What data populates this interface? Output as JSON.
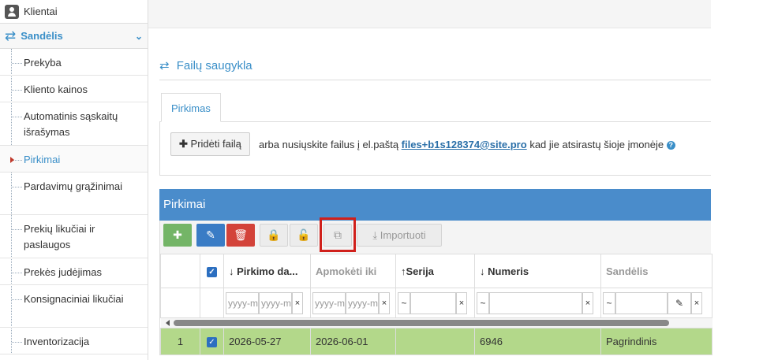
{
  "sidebar": {
    "top_item": "Klientai",
    "section": "Sandėlis",
    "items": [
      {
        "label": "Prekyba"
      },
      {
        "label": "Kliento kainos"
      },
      {
        "label": "Automatinis sąskaitų išrašymas"
      },
      {
        "label": "Pirkimai"
      },
      {
        "label": "Pardavimų grąžinimai"
      },
      {
        "label": "Prekių likučiai ir paslaugos"
      },
      {
        "label": "Prekės judėjimas"
      },
      {
        "label": "Konsignaciniai likučiai"
      },
      {
        "label": "Inventorizacija"
      }
    ]
  },
  "main": {
    "storage_title": "Failų saugykla",
    "tab_label": "Pirkimas",
    "add_file_label": "Pridėti failą",
    "upload_prefix": "arba nusiųskite failus į el.paštą",
    "upload_email": "files+b1s128374@site.pro",
    "upload_suffix": "kad jie atsirastų šioje įmonėje"
  },
  "grid": {
    "title": "Pirkimai",
    "import_label": "Importuoti",
    "columns": {
      "date": "Pirkimo da...",
      "pay_until": "Apmokėti iki",
      "series": "Serija",
      "number": "Numeris",
      "warehouse": "Sandėlis"
    },
    "filter_placeholder": "yyyy-mm-dd",
    "rows": [
      {
        "index": "1",
        "date": "2026-05-27",
        "pay_until": "2026-06-01",
        "series": "",
        "number": "6946",
        "warehouse": "Pagrindinis"
      }
    ]
  },
  "colors": {
    "accent": "#3a8fc8",
    "header_bar": "#4a8ccb",
    "row_selected": "#b3d88a",
    "highlight": "#d0201b"
  }
}
